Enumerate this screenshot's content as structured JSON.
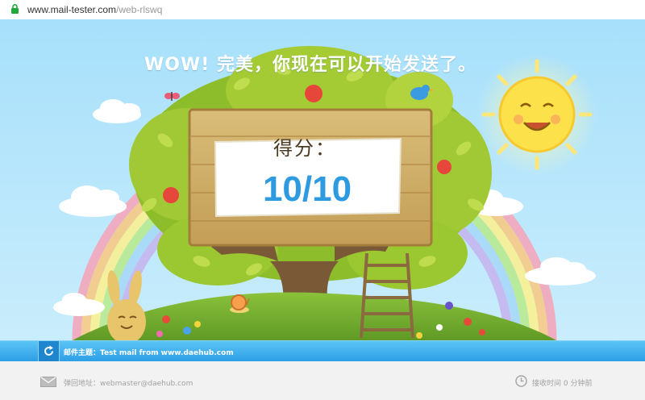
{
  "browser": {
    "url_host": "www.mail-tester.com",
    "url_path": "/web-rlswq",
    "icon": "lock-icon"
  },
  "result": {
    "headline": "WOW! 完美，你现在可以开始发送了。",
    "score_label": "得分：",
    "score_value": "10/10"
  },
  "subject_bar": {
    "icon": "refresh-icon",
    "label": "邮件主题：",
    "value": "Test mail from www.daehub.com"
  },
  "footer": {
    "bounce_label": "弹回地址：",
    "bounce_value": "webmaster@daehub.com",
    "received": "接收时间 0 分钟前"
  },
  "colors": {
    "sky": "#a9e1fb",
    "score": "#2e9be0",
    "bar": "#3aade9",
    "secure": "#22a83a"
  }
}
